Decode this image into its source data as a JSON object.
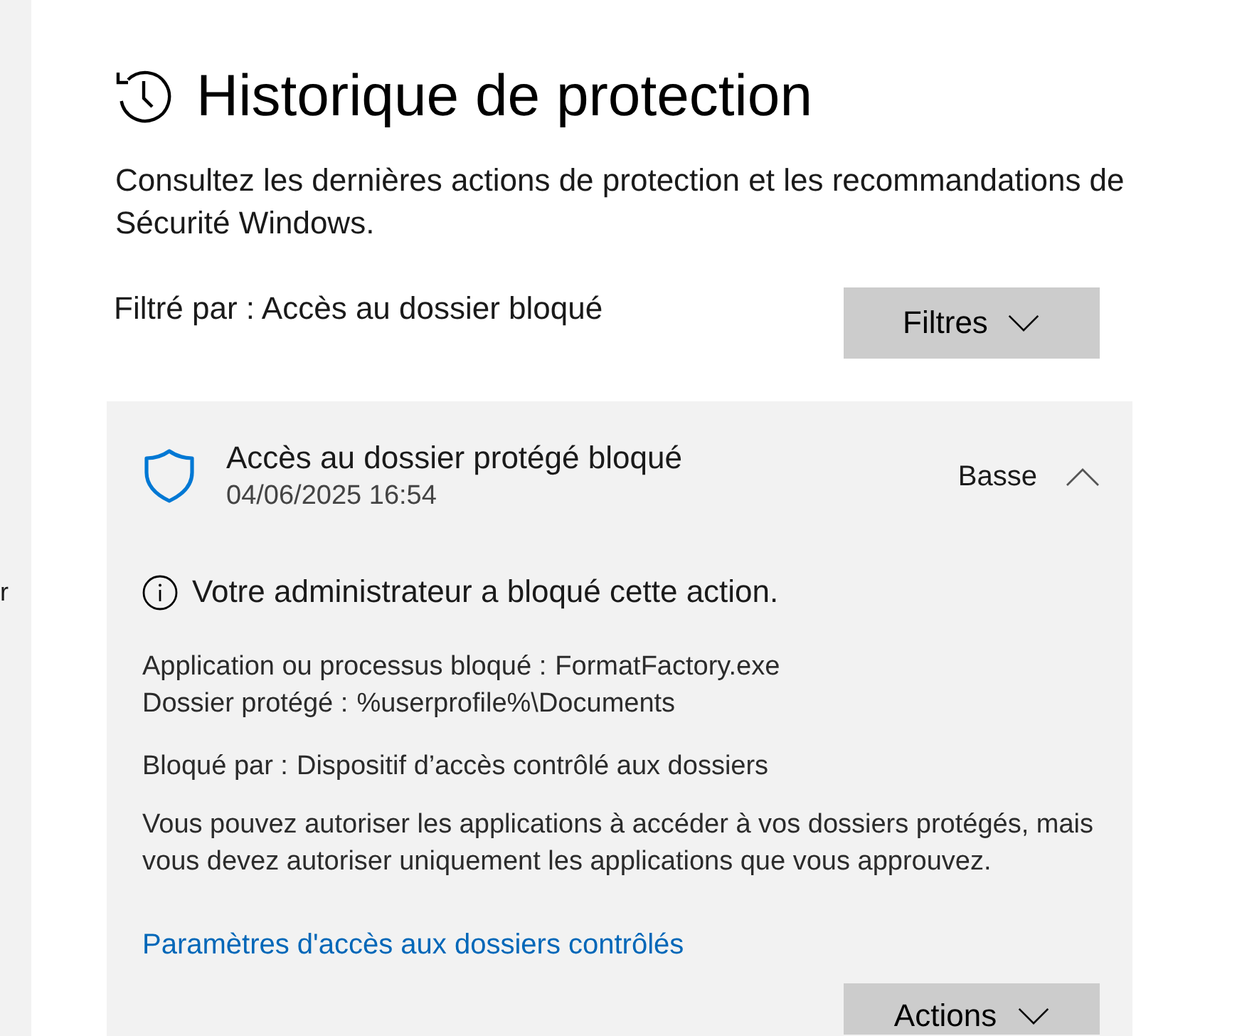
{
  "sidebar": {
    "items": [
      {
        "label": "r"
      }
    ]
  },
  "header": {
    "title": "Historique de protection",
    "description": "Consultez les dernières actions de protection et les recommandations de Sécurité Windows."
  },
  "filter": {
    "label": "Filtré par : Accès au dossier bloqué",
    "button": "Filtres"
  },
  "events": [
    {
      "title": "Accès au dossier protégé bloqué",
      "timestamp": "04/06/2025 16:54",
      "severity": "Basse",
      "expanded": true,
      "notice": "Votre administrateur a bloqué cette action.",
      "details": [
        {
          "label": "Application ou processus bloqué :",
          "value": "FormatFactory.exe"
        },
        {
          "label": "Dossier protégé :",
          "value": "%userprofile%\\Documents"
        }
      ],
      "blocked_by": {
        "label": "Bloqué par :",
        "value": "Dispositif d’accès contrôlé aux dossiers"
      },
      "explanation": "Vous pouvez autoriser les applications à accéder à vos dossiers protégés, mais vous devez autoriser uniquement les applications que vous approuvez.",
      "link": "Paramètres d'accès aux dossiers contrôlés",
      "actions_button": "Actions"
    }
  ]
}
